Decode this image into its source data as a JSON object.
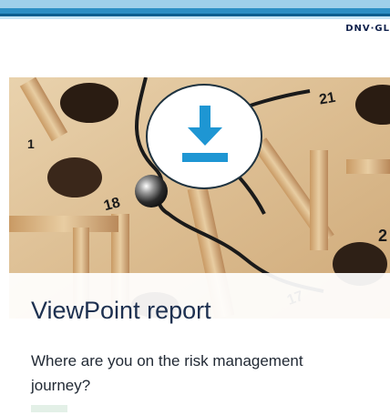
{
  "header": {
    "brand_logo": "DNV·GL",
    "stripe_colors": [
      "#9fd0ea",
      "#2d8fc4",
      "#0a5f8f",
      "#c7e6f5"
    ]
  },
  "hero": {
    "board_numbers": [
      "1",
      "18",
      "21",
      "2",
      "17"
    ],
    "download_icon": "download-icon",
    "accent_color": "#1e96d3"
  },
  "card": {
    "title": "ViewPoint report",
    "description": "Where are you on the risk management journey?"
  }
}
